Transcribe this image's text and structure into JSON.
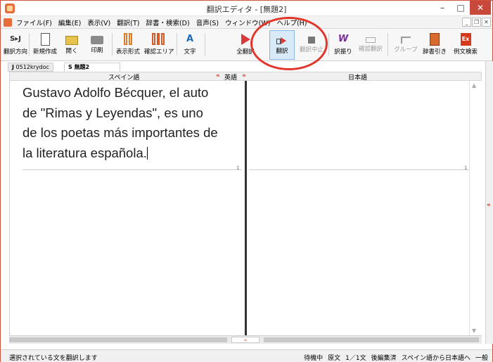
{
  "window": {
    "title": "翻訳エディタ - [無題2]"
  },
  "menu": {
    "items": [
      "ファイル(F)",
      "編集(E)",
      "表示(V)",
      "翻訳(T)",
      "辞書・検索(D)",
      "音声(S)",
      "ウィンドウ(W)",
      "ヘルプ(H)"
    ]
  },
  "toolbar": {
    "buttons": [
      {
        "label": "翻訳方向",
        "icon": "sj-direction-icon",
        "glyph": "S▸J"
      },
      {
        "label": "新規作成",
        "icon": "new-document-icon"
      },
      {
        "label": "開く",
        "icon": "open-folder-icon"
      },
      {
        "label": "印刷",
        "icon": "printer-icon"
      },
      {
        "label": "表示形式",
        "icon": "display-format-icon"
      },
      {
        "label": "確認エリア",
        "icon": "confirm-area-icon"
      },
      {
        "label": "文字",
        "icon": "font-icon",
        "glyph": "A"
      },
      {
        "label": "全翻訳",
        "icon": "translate-all-icon"
      },
      {
        "label": "翻訳",
        "icon": "translate-icon"
      },
      {
        "label": "翻訳中止",
        "icon": "stop-icon"
      },
      {
        "label": "訳振り",
        "icon": "translation-assign-icon",
        "glyph": "W"
      },
      {
        "label": "確認翻訳",
        "icon": "confirm-translate-icon"
      },
      {
        "label": "グループ",
        "icon": "group-icon"
      },
      {
        "label": "辞書引き",
        "icon": "dictionary-lookup-icon"
      },
      {
        "label": "例文検索",
        "icon": "example-search-icon",
        "glyph": "Ex"
      }
    ]
  },
  "doc_tabs": [
    {
      "prefix": "J",
      "name": "0512krydoc"
    },
    {
      "prefix": "S",
      "name": "無題2"
    }
  ],
  "columns": {
    "source": "スペイン語",
    "middle": "英語",
    "target": "日本語",
    "chev_left": "«",
    "chev_right": "»"
  },
  "source_text": {
    "lines": [
      "Gustavo Adolfo Bécquer, el auto",
      "de \"Rimas y Leyendas\", es uno",
      "de los poetas más importantes de",
      "la literatura española."
    ]
  },
  "sentence_number": "1",
  "status": {
    "hint": "選択されている文を翻訳します",
    "state": "待機中",
    "source_label": "原文",
    "position": "1／1文",
    "edited": "後編集済",
    "direction": "スペイン語から日本語へ",
    "mode": "一般"
  },
  "colors": {
    "accent_red": "#d23b2e",
    "highlight_blue": "#d8e9f8"
  }
}
